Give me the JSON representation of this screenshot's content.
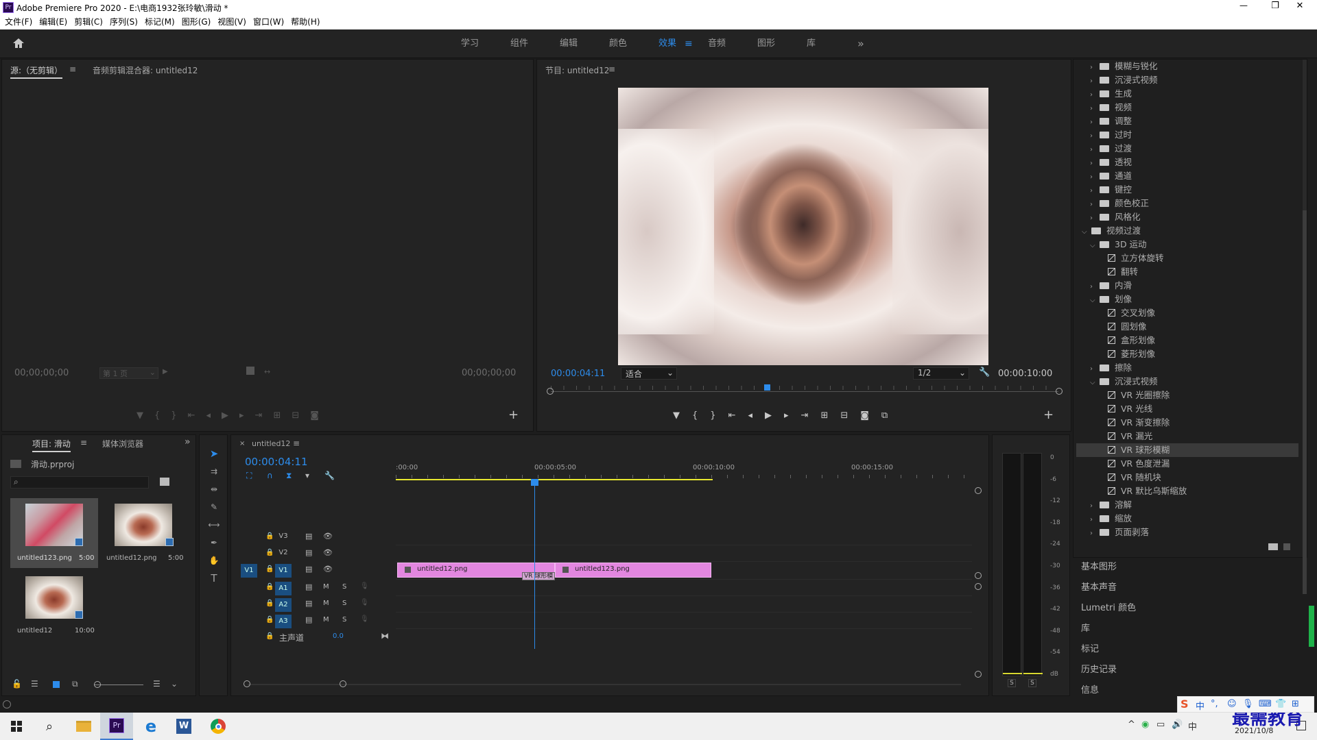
{
  "window": {
    "title": "Adobe Premiere Pro 2020 - E:\\电商1932张玲敏\\滑动 *",
    "minimize": "—",
    "maximize": "❐",
    "close": "✕"
  },
  "menu": [
    "文件(F)",
    "编辑(E)",
    "剪辑(C)",
    "序列(S)",
    "标记(M)",
    "图形(G)",
    "视图(V)",
    "窗口(W)",
    "帮助(H)"
  ],
  "workspaces": {
    "items": [
      "学习",
      "组件",
      "编辑",
      "颜色",
      "效果",
      "音频",
      "图形",
      "库"
    ],
    "active": "效果",
    "more": "»"
  },
  "source": {
    "tab1": "源:（无剪辑）",
    "tab2": "音频剪辑混合器: untitled12",
    "time_left": "00;00;00;00",
    "page": "第 1 页",
    "time_right": "00;00;00;00"
  },
  "program": {
    "title": "节目: untitled12",
    "timecode": "00:00:04:11",
    "fit": "适合",
    "resolution": "1/2",
    "duration": "00:00:10:00"
  },
  "project": {
    "tab1": "项目: 滑动",
    "tab2": "媒体浏览器",
    "file": "滑动.prproj",
    "items": [
      {
        "name": "untitled123.png",
        "dur": "5:00"
      },
      {
        "name": "untitled12.png",
        "dur": "5:00"
      },
      {
        "name": "untitled12",
        "dur": "10:00"
      }
    ]
  },
  "timeline": {
    "tab": "untitled12",
    "timecode": "00:00:04:11",
    "ruler": [
      ":00:00",
      "00:00:05:00",
      "00:00:10:00",
      "00:00:15:00"
    ],
    "tracks": {
      "v3": "V3",
      "v2": "V2",
      "v1": "V1",
      "v1src": "V1",
      "a1": "A1",
      "a2": "A2",
      "a3": "A3",
      "master": "主声道",
      "master_val": "0.0",
      "m": "M",
      "s": "S"
    },
    "clips": {
      "clip1": "untitled12.png",
      "clip2": "untitled123.png",
      "transition": "VR 球形模"
    }
  },
  "audio_meter": {
    "labels": [
      "0",
      "-6",
      "-12",
      "-18",
      "-24",
      "-30",
      "-36",
      "-42",
      "-48",
      "-54",
      "dB"
    ],
    "s1": "S",
    "s2": "S"
  },
  "effects": {
    "rows": [
      {
        "label": "模糊与锐化",
        "kind": "folder",
        "level": 1,
        "open": false
      },
      {
        "label": "沉浸式视频",
        "kind": "folder",
        "level": 1,
        "open": false
      },
      {
        "label": "生成",
        "kind": "folder",
        "level": 1,
        "open": false
      },
      {
        "label": "视频",
        "kind": "folder",
        "level": 1,
        "open": false
      },
      {
        "label": "调整",
        "kind": "folder",
        "level": 1,
        "open": false
      },
      {
        "label": "过时",
        "kind": "folder",
        "level": 1,
        "open": false
      },
      {
        "label": "过渡",
        "kind": "folder",
        "level": 1,
        "open": false
      },
      {
        "label": "透视",
        "kind": "folder",
        "level": 1,
        "open": false
      },
      {
        "label": "通道",
        "kind": "folder",
        "level": 1,
        "open": false
      },
      {
        "label": "键控",
        "kind": "folder",
        "level": 1,
        "open": false
      },
      {
        "label": "颜色校正",
        "kind": "folder",
        "level": 1,
        "open": false
      },
      {
        "label": "风格化",
        "kind": "folder",
        "level": 1,
        "open": false
      },
      {
        "label": "视频过渡",
        "kind": "folder",
        "level": 0,
        "open": true
      },
      {
        "label": "3D 运动",
        "kind": "folder",
        "level": 1,
        "open": true
      },
      {
        "label": "立方体旋转",
        "kind": "preset",
        "level": 2
      },
      {
        "label": "翻转",
        "kind": "preset",
        "level": 2
      },
      {
        "label": "内滑",
        "kind": "folder",
        "level": 1,
        "open": false
      },
      {
        "label": "划像",
        "kind": "folder",
        "level": 1,
        "open": true
      },
      {
        "label": "交叉划像",
        "kind": "preset",
        "level": 2
      },
      {
        "label": "圆划像",
        "kind": "preset",
        "level": 2
      },
      {
        "label": "盒形划像",
        "kind": "preset",
        "level": 2
      },
      {
        "label": "菱形划像",
        "kind": "preset",
        "level": 2
      },
      {
        "label": "擦除",
        "kind": "folder",
        "level": 1,
        "open": false
      },
      {
        "label": "沉浸式视频",
        "kind": "folder",
        "level": 1,
        "open": true
      },
      {
        "label": "VR 光圈擦除",
        "kind": "preset",
        "level": 2
      },
      {
        "label": "VR 光线",
        "kind": "preset",
        "level": 2
      },
      {
        "label": "VR 渐变擦除",
        "kind": "preset",
        "level": 2
      },
      {
        "label": "VR 漏光",
        "kind": "preset",
        "level": 2
      },
      {
        "label": "VR 球形模糊",
        "kind": "preset",
        "level": 2,
        "selected": true
      },
      {
        "label": "VR 色度泄漏",
        "kind": "preset",
        "level": 2
      },
      {
        "label": "VR 随机块",
        "kind": "preset",
        "level": 2
      },
      {
        "label": "VR 默比乌斯缩放",
        "kind": "preset",
        "level": 2
      },
      {
        "label": "溶解",
        "kind": "folder",
        "level": 1,
        "open": false
      },
      {
        "label": "缩放",
        "kind": "folder",
        "level": 1,
        "open": false
      },
      {
        "label": "页面剥落",
        "kind": "folder",
        "level": 1,
        "open": false
      }
    ],
    "side_panels": [
      "基本图形",
      "基本声音",
      "Lumetri 颜色",
      "库",
      "标记",
      "历史记录",
      "信息"
    ]
  },
  "taskbar": {
    "date": "2021/10/8",
    "ime": "中",
    "watermark": "最需教育"
  },
  "colors": {
    "accent": "#2d8ceb",
    "clip": "#e387e0",
    "playhead": "#2d8ceb",
    "workarea": "#e9e930"
  }
}
